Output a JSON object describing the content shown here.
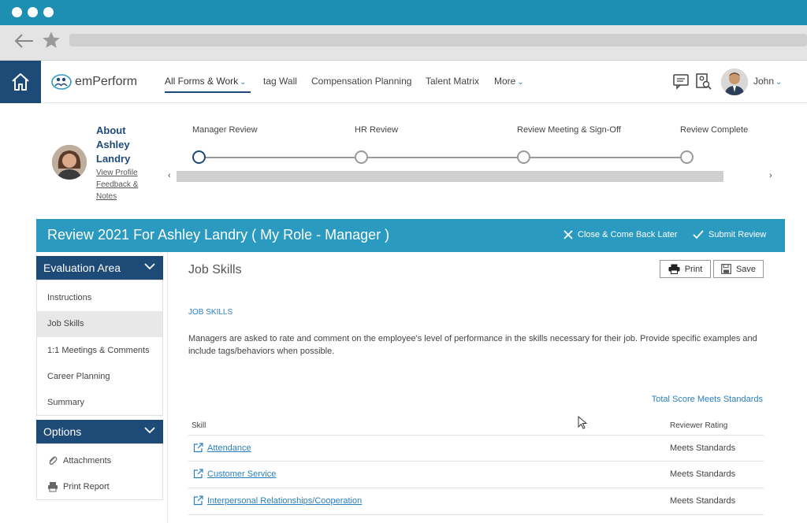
{
  "app": {
    "logo_text": "emPerform",
    "nav_items": [
      {
        "label": "All Forms & Work",
        "has_caret": true
      },
      {
        "label": "tag Wall"
      },
      {
        "label": "Compensation Planning"
      },
      {
        "label": "Talent Matrix"
      },
      {
        "label": "More",
        "has_caret": true
      }
    ],
    "user_name": "John",
    "caret": "⌄"
  },
  "about": {
    "title": "About Ashley Landry",
    "links": [
      "View Profile",
      "Feedback &",
      "Notes"
    ]
  },
  "stepper": {
    "steps": [
      "Manager Review",
      "HR Review",
      "Review Meeting & Sign-Off",
      "Review Complete"
    ],
    "current_index": 0,
    "scroll_left": "‹",
    "scroll_right": "›"
  },
  "review": {
    "title": "Review 2021 For Ashley Landry ( My Role - Manager )",
    "close_label": "Close & Come Back Later",
    "submit_label": "Submit Review"
  },
  "sidebar": {
    "evaluation_title": "Evaluation Area",
    "evaluation_items": [
      "Instructions",
      "Job Skills",
      "1:1 Meetings & Comments",
      "Career Planning",
      "Summary"
    ],
    "selected_index": 1,
    "options_title": "Options",
    "option_items": [
      "Attachments",
      "Print Report"
    ]
  },
  "main": {
    "title": "Job Skills",
    "print_label": "Print",
    "save_label": "Save",
    "section_label": "JOB SKILLS",
    "description": "Managers are asked to rate and comment on the employee's level of performance in the skills necessary for their job. Provide specific examples and include tags/behaviors when possible.",
    "total_score": "Total Score Meets Standards",
    "columns": {
      "skill": "Skill",
      "rating": "Reviewer Rating"
    },
    "skills": [
      {
        "name": "Attendance",
        "rating": "Meets Standards"
      },
      {
        "name": "Customer Service",
        "rating": "Meets Standards"
      },
      {
        "name": "Interpersonal Relationships/Cooperation",
        "rating": "Meets Standards"
      }
    ]
  },
  "colors": {
    "chrome": "#1d8fb3",
    "navy": "#1e4a78",
    "review_bar": "#2a9ac0",
    "link": "#2a7fc0"
  }
}
